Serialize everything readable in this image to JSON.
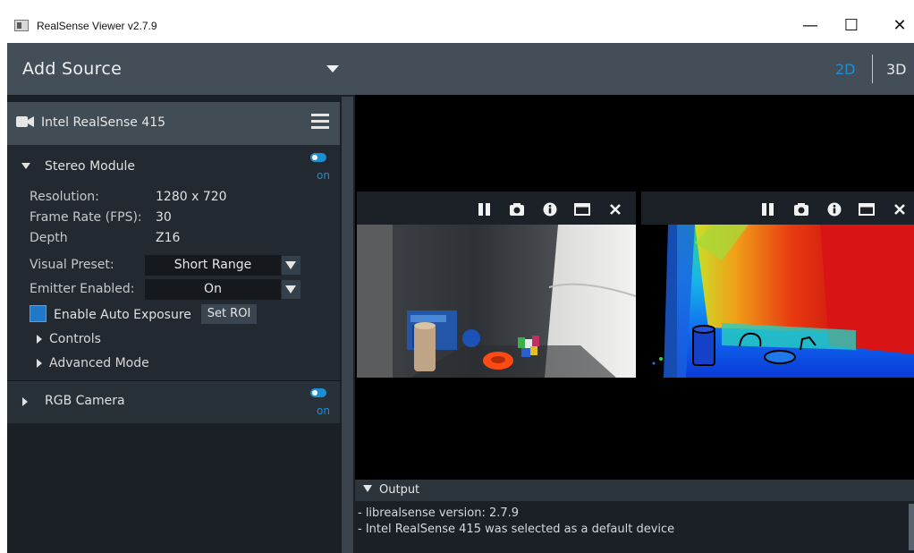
{
  "window": {
    "title": "RealSense Viewer v2.7.9",
    "controls": {
      "minimize": "—",
      "maximize": "☐",
      "close": "✕"
    }
  },
  "sidebar": {
    "add_source": "Add Source",
    "device": {
      "name": "Intel RealSense 415",
      "stereo_module": {
        "title": "Stereo Module",
        "toggle_state": "on",
        "resolution_label": "Resolution:",
        "resolution_value": "1280 x 720",
        "frame_rate_label": "Frame Rate (FPS):",
        "frame_rate_value": "30",
        "depth_label": "Depth",
        "depth_value": "Z16",
        "visual_preset_label": "Visual Preset:",
        "visual_preset_value": "Short Range",
        "emitter_label": "Emitter Enabled:",
        "emitter_value": "On",
        "auto_exposure_label": "Enable Auto Exposure",
        "auto_exposure_checked": true,
        "set_roi_label": "Set ROI",
        "controls_label": "Controls",
        "advanced_label": "Advanced Mode"
      },
      "rgb_camera": {
        "title": "RGB Camera",
        "toggle_state": "on"
      }
    }
  },
  "view_modes": {
    "mode_2d": "2D",
    "mode_3d": "3D",
    "active": "2D"
  },
  "streams": [
    {
      "type": "color",
      "icons": [
        "pause-icon",
        "camera-icon",
        "info-icon",
        "maximize-icon",
        "close-icon"
      ]
    },
    {
      "type": "depth",
      "icons": [
        "pause-icon",
        "camera-icon",
        "info-icon",
        "maximize-icon",
        "close-icon"
      ]
    }
  ],
  "output": {
    "title": "Output",
    "lines": [
      "- librealsense version: 2.7.9",
      "- Intel RealSense 415 was selected as a default device"
    ]
  },
  "colors": {
    "accent": "#1b8fd6",
    "panel": "#1b2026",
    "header": "#434e58"
  }
}
